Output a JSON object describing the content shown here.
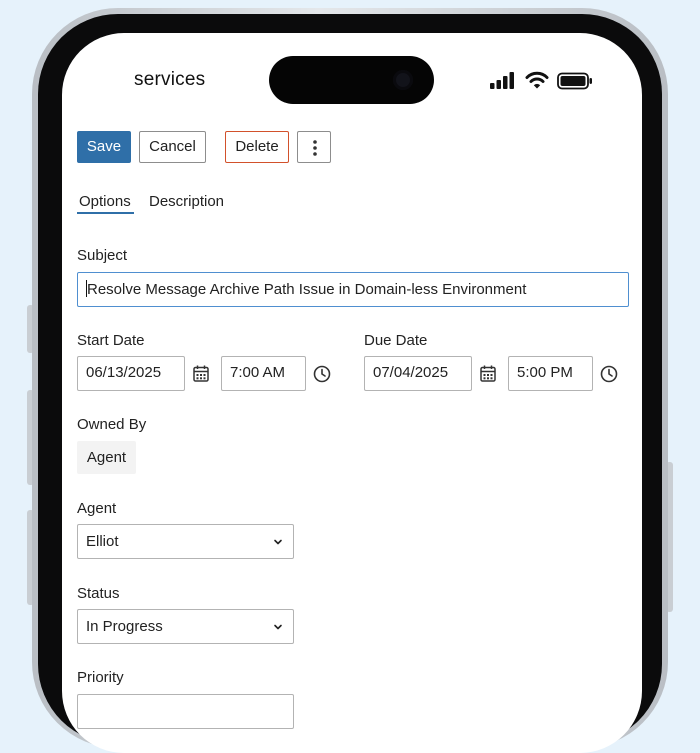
{
  "status_bar": {
    "carrier": "services"
  },
  "toolbar": {
    "save_label": "Save",
    "cancel_label": "Cancel",
    "delete_label": "Delete"
  },
  "tabs": [
    {
      "label": "Options",
      "active": true
    },
    {
      "label": "Description",
      "active": false
    }
  ],
  "form": {
    "subject_label": "Subject",
    "subject_value": "Resolve Message Archive Path Issue in Domain-less Environment",
    "start_date_label": "Start Date",
    "start_date": "06/13/2025",
    "start_time": "7:00 AM",
    "due_date_label": "Due Date",
    "due_date": "07/04/2025",
    "due_time": "5:00 PM",
    "owned_by_label": "Owned By",
    "owned_by_value": "Agent",
    "agent_label": "Agent",
    "agent_value": "Elliot",
    "status_label": "Status",
    "status_value": "In Progress",
    "priority_label": "Priority"
  },
  "colors": {
    "primary": "#2f6fa8",
    "delete_border": "#d2512b",
    "focus_border": "#4f8fd0",
    "background": "#e6f2fb"
  },
  "icons": {
    "date_picker": "calendar-icon",
    "time_picker": "clock-icon",
    "menu": "more-vertical-icon",
    "select": "chevron-down-icon"
  }
}
